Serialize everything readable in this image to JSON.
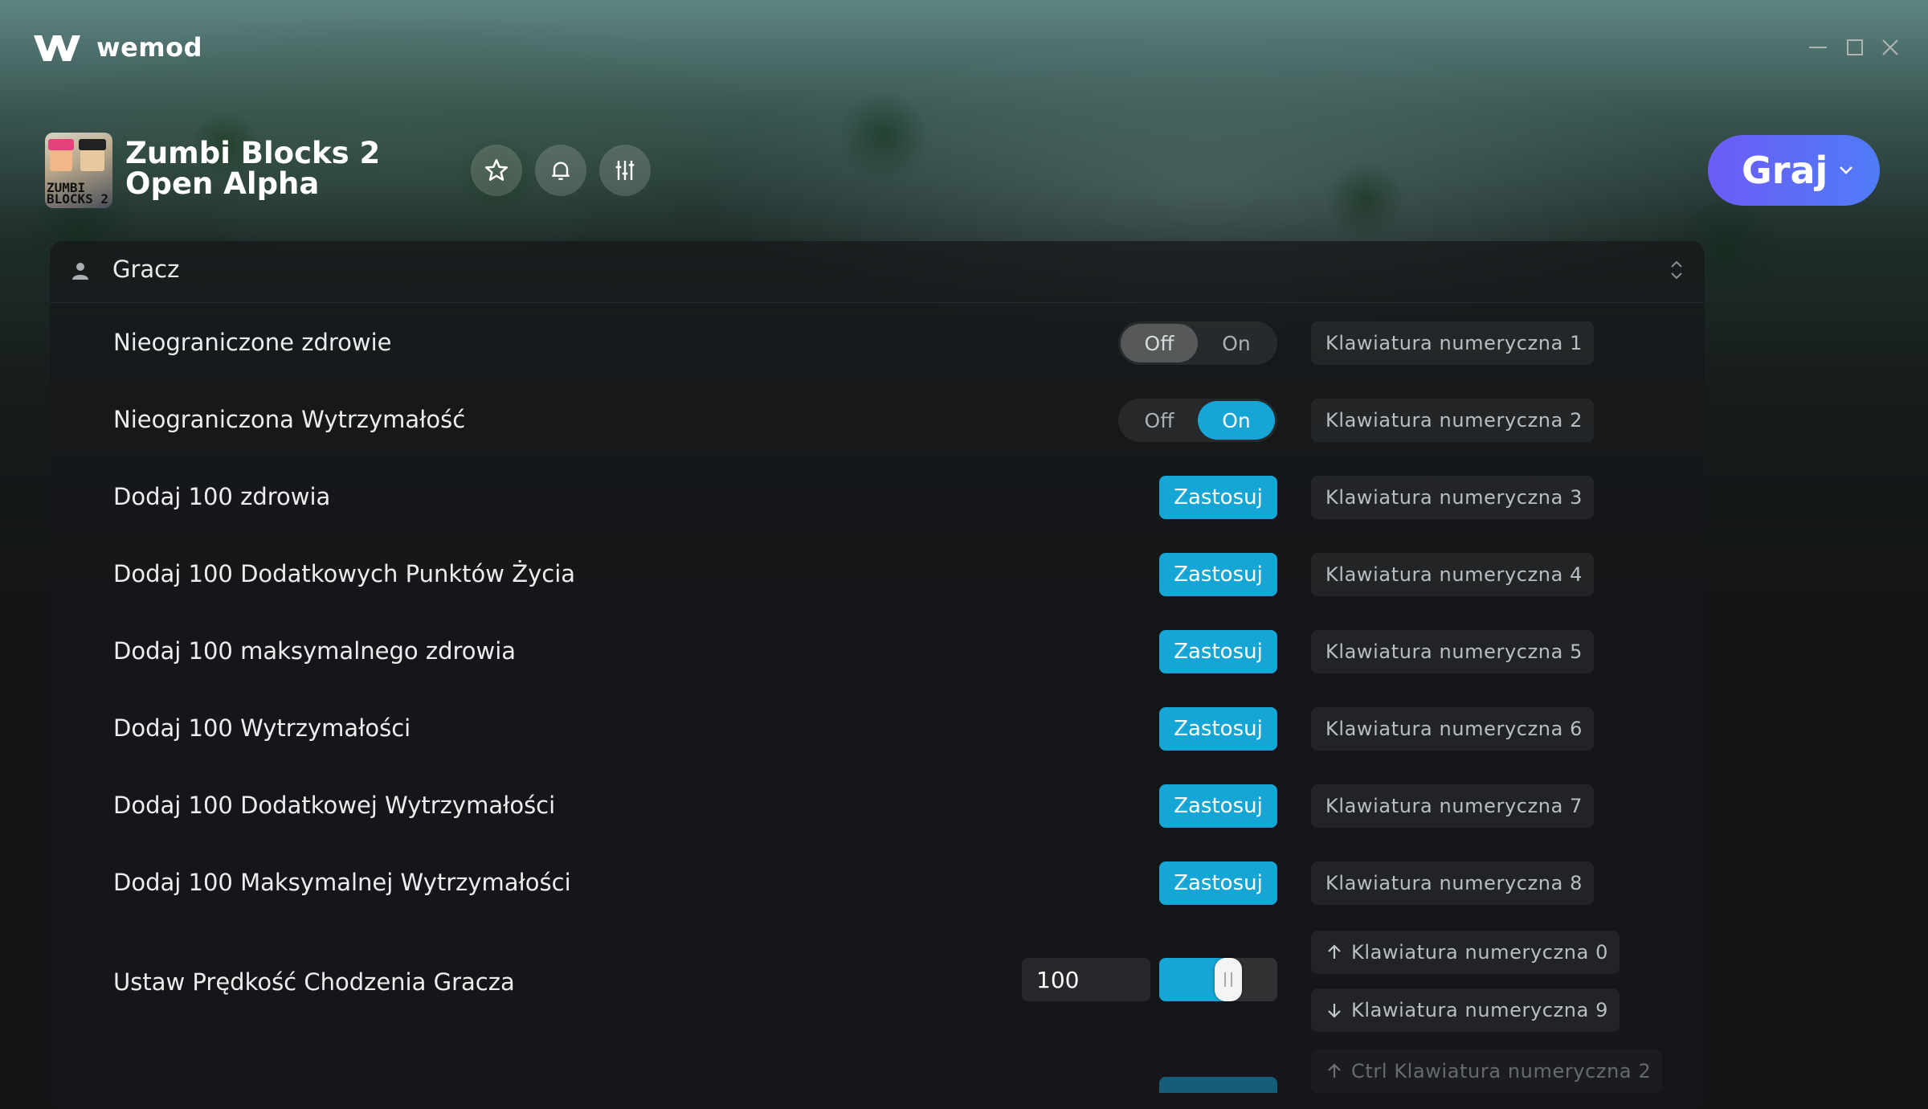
{
  "app": {
    "brand": "wemod"
  },
  "window_controls": [
    "minimize-icon",
    "maximize-icon",
    "close-icon"
  ],
  "game": {
    "title": "Zumbi Blocks 2 Open Alpha",
    "thumb_text": "ZUMBI BLOCKS 2",
    "actions": [
      "star-icon",
      "bell-icon",
      "sliders-icon"
    ],
    "play_label": "Graj"
  },
  "section": {
    "label": "Gracz"
  },
  "cheats": [
    {
      "label": "Nieograniczone zdrowie",
      "type": "toggle",
      "off": "Off",
      "on": "On",
      "state": "off",
      "hotkey": "Klawiatura numeryczna 1"
    },
    {
      "label": "Nieograniczona Wytrzymałość",
      "type": "toggle",
      "off": "Off",
      "on": "On",
      "state": "on",
      "hotkey": "Klawiatura numeryczna 2"
    },
    {
      "label": "Dodaj 100 zdrowia",
      "type": "button",
      "button": "Zastosuj",
      "hotkey": "Klawiatura numeryczna 3"
    },
    {
      "label": "Dodaj 100 Dodatkowych Punktów Życia",
      "type": "button",
      "button": "Zastosuj",
      "hotkey": "Klawiatura numeryczna 4"
    },
    {
      "label": "Dodaj 100 maksymalnego zdrowia",
      "type": "button",
      "button": "Zastosuj",
      "hotkey": "Klawiatura numeryczna 5"
    },
    {
      "label": "Dodaj 100 Wytrzymałości",
      "type": "button",
      "button": "Zastosuj",
      "hotkey": "Klawiatura numeryczna 6"
    },
    {
      "label": "Dodaj 100 Dodatkowej Wytrzymałości",
      "type": "button",
      "button": "Zastosuj",
      "hotkey": "Klawiatura numeryczna 7"
    },
    {
      "label": "Dodaj 100 Maksymalnej Wytrzymałości",
      "type": "button",
      "button": "Zastosuj",
      "hotkey": "Klawiatura numeryczna 8"
    },
    {
      "label": "Ustaw Prędkość Chodzenia Gracza",
      "type": "slider",
      "value": "100",
      "fill_fraction": 0.5,
      "hotkey_up": "Klawiatura numeryczna 0",
      "hotkey_down": "Klawiatura numeryczna 9"
    }
  ],
  "next_hotkey": "Ctrl Klawiatura numeryczna 2",
  "colors": {
    "accent": "#16a6d6",
    "play_start": "#6c5cf6",
    "play_end": "#4f7cf7"
  }
}
